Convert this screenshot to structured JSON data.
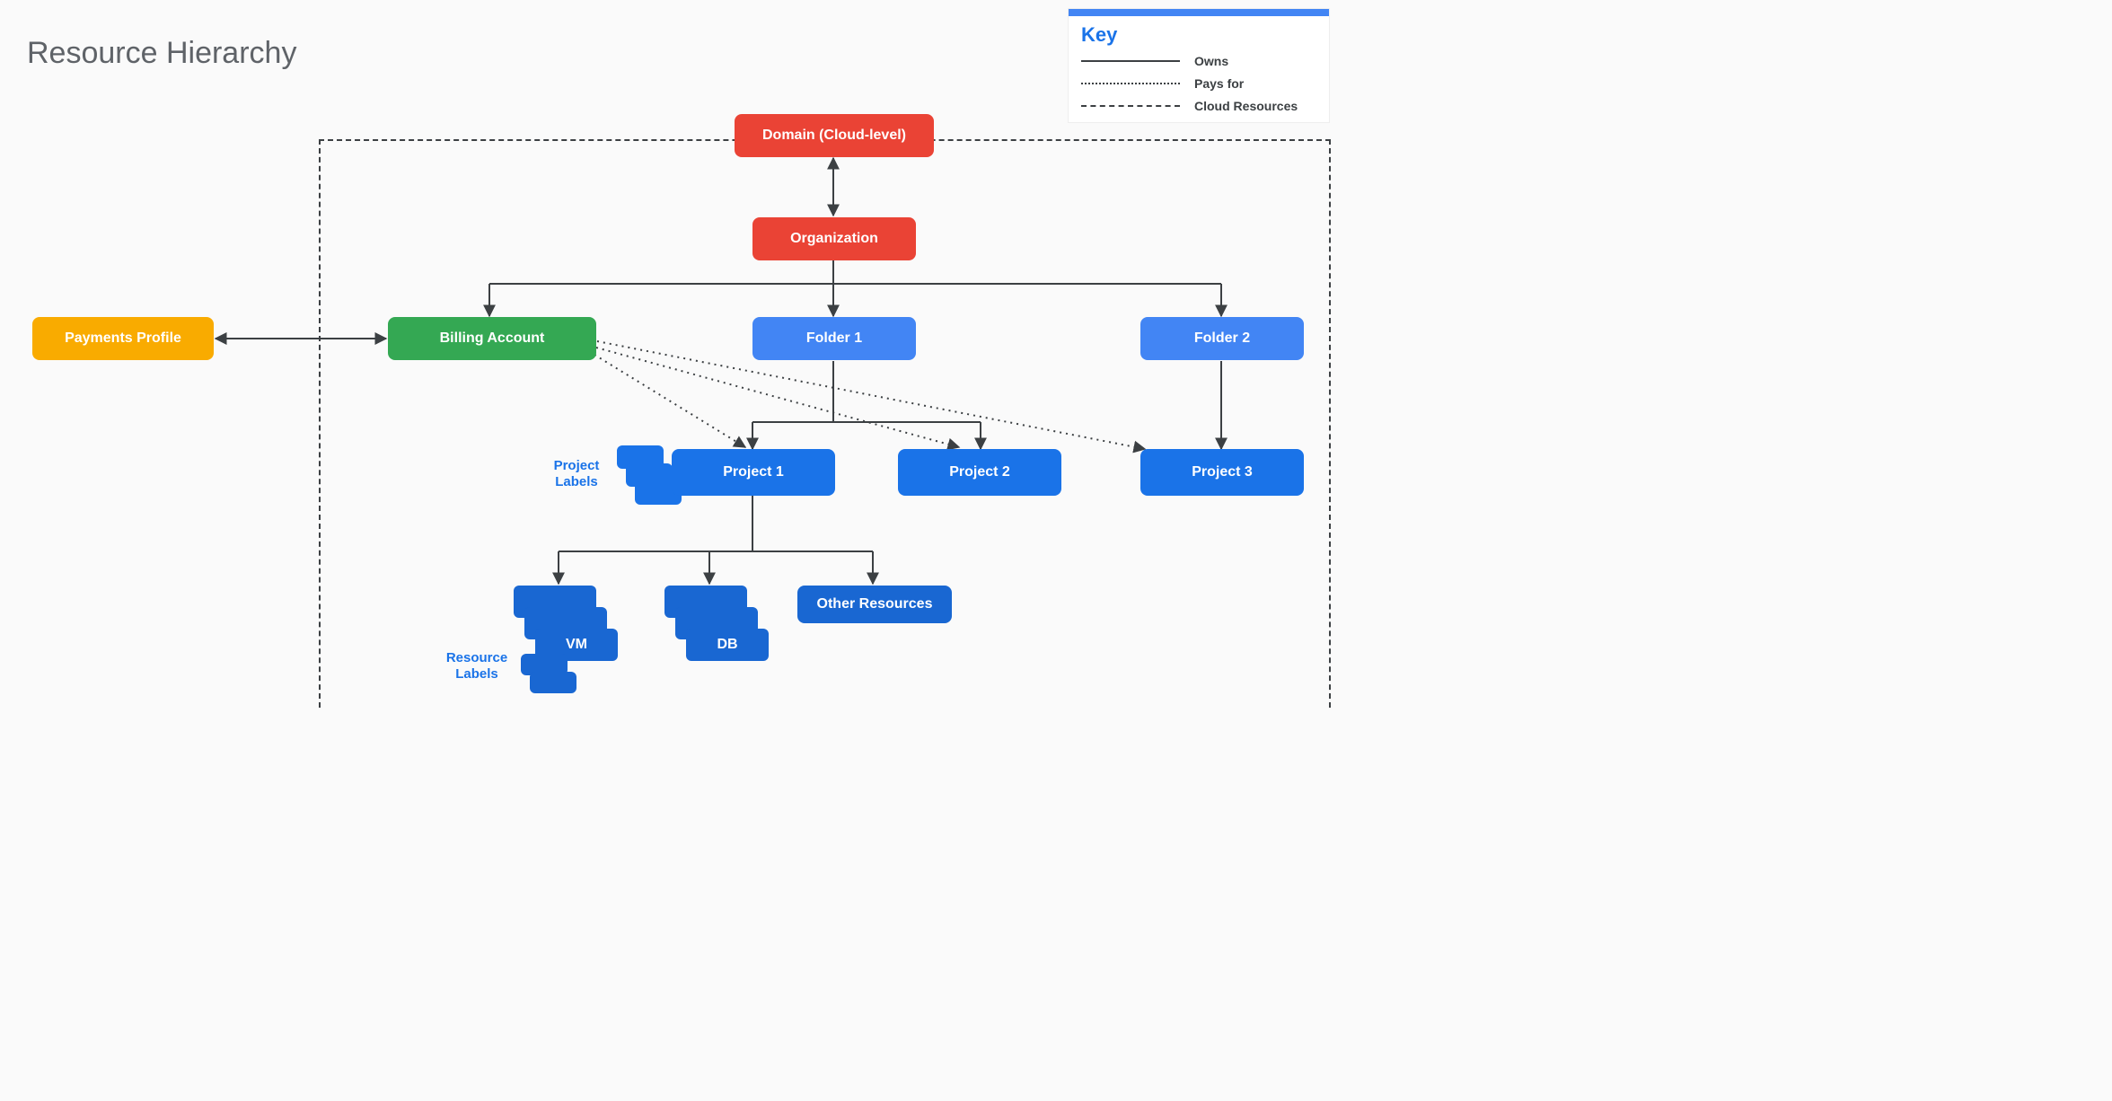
{
  "title": "Resource Hierarchy",
  "key": {
    "title": "Key",
    "owns": "Owns",
    "pays_for": "Pays for",
    "cloud_resources": "Cloud Resources"
  },
  "nodes": {
    "domain": "Domain (Cloud-level)",
    "organization": "Organization",
    "payments_profile": "Payments Profile",
    "billing_account": "Billing Account",
    "folder1": "Folder 1",
    "folder2": "Folder 2",
    "project1": "Project 1",
    "project2": "Project 2",
    "project3": "Project 3",
    "vm": "VM",
    "db": "DB",
    "other_resources": "Other Resources"
  },
  "labels": {
    "project_labels": "Project Labels",
    "resource_labels": "Resource Labels"
  }
}
